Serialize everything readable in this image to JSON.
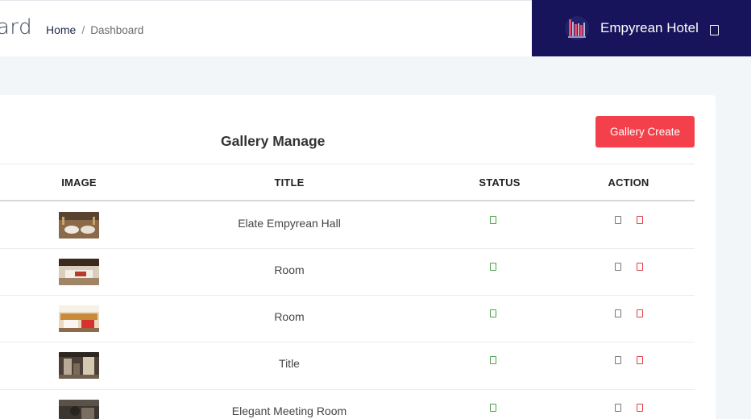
{
  "header": {
    "page_title_fragment": "ard",
    "breadcrumb": {
      "home": "Home",
      "separator": "/",
      "current": "Dashboard"
    }
  },
  "brand": {
    "name": "Empyrean Hotel",
    "logo_icon": "hotel-logo-icon",
    "toggle_icon": "menu-toggle-icon",
    "background_color": "#17145b"
  },
  "gallery": {
    "title": "Gallery Manage",
    "create_button_label": "Gallery Create",
    "create_button_color": "#f3404a",
    "columns": [
      "IMAGE",
      "TITLE",
      "STATUS",
      "ACTION"
    ],
    "rows": [
      {
        "title": "Elate Empyrean Hall",
        "status_icon": "status-active-icon",
        "actions": [
          "edit-icon",
          "delete-icon"
        ]
      },
      {
        "title": "Room",
        "status_icon": "status-active-icon",
        "actions": [
          "edit-icon",
          "delete-icon"
        ]
      },
      {
        "title": "Room",
        "status_icon": "status-active-icon",
        "actions": [
          "edit-icon",
          "delete-icon"
        ]
      },
      {
        "title": "Title",
        "status_icon": "status-active-icon",
        "actions": [
          "edit-icon",
          "delete-icon"
        ]
      },
      {
        "title": "Elegant Meeting Room",
        "status_icon": "status-active-icon",
        "actions": [
          "edit-icon",
          "delete-icon"
        ]
      }
    ]
  },
  "colors": {
    "status": "#4aa14a",
    "delete": "#e0404a",
    "edit": "#777777"
  }
}
